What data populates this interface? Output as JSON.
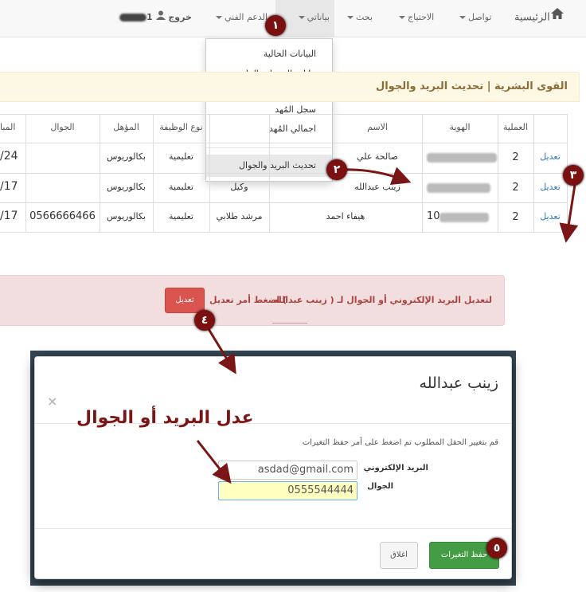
{
  "navbar": {
    "home": "الرئيسية",
    "contact": "تواصل",
    "needs": "الاحتياج",
    "search": "بحث",
    "my_data": "بياناتي",
    "tech_support": "الدعم الفني",
    "logout": "خروج",
    "user_suffix": "1"
  },
  "dropdown": {
    "items": [
      "البيانات الحالية",
      "بيانات السنوات الماضية",
      "سجل المُهد",
      "اجمالي المُهد",
      "تحديث البريد والجوال"
    ]
  },
  "panel": {
    "title": "القوى البشرية | تحديث البريد والجوال"
  },
  "table": {
    "headers": [
      "",
      "العملية",
      "الهوية",
      "الاسم",
      "نوع الوظيفة",
      "المؤهل",
      "الجوال",
      "المبا"
    ],
    "rows": [
      {
        "action": "تعديل",
        "op": "2",
        "name": "صالحة علي",
        "job_type": "تعليمية",
        "qualification": "بكالوريوس",
        "mobile": "",
        "date": "/24"
      },
      {
        "action": "تعديل",
        "op": "2",
        "name": "زينب عبدالله",
        "role": "وكيل",
        "job_type": "تعليمية",
        "qualification": "بكالوريوس",
        "mobile": "",
        "date": "/17"
      },
      {
        "action": "تعديل",
        "op": "2",
        "id_prefix": "10",
        "name": "هيفاء احمد",
        "role": "مرشد طلابي",
        "job_type": "تعليمية",
        "qualification": "بكالوريوس",
        "mobile": "0566666466",
        "date": "/17"
      }
    ]
  },
  "alert": {
    "text_right": "لتعديل البريد الإلكتروني أو الجوال لـ ( زينب عبدالله",
    "text_left": ") اضغط أمر تعديل",
    "button": "تعديل"
  },
  "modal": {
    "title": "زينب عبدالله",
    "close": "×",
    "instruction": "قم بتغيير الحقل المطلوب تم اضغط على أمر حفظ التغيرات",
    "email_label": "البريد الإلكتروني",
    "email_value": "asdad@gmail.com",
    "mobile_label": "الجوال",
    "mobile_value": "0555544444",
    "save_button": "حفظ التغيرات",
    "close_button": "اغلاق"
  },
  "annotations": {
    "heading": "عدل البريد أو الجوال",
    "badges": [
      "١",
      "٢",
      "٣",
      "٤",
      "٥"
    ]
  },
  "colors": {
    "annotation": "#7a1616",
    "alert_bg": "#f2dede",
    "panel_bg": "#fcf8e3",
    "save": "#449d44",
    "danger": "#d9534f"
  }
}
